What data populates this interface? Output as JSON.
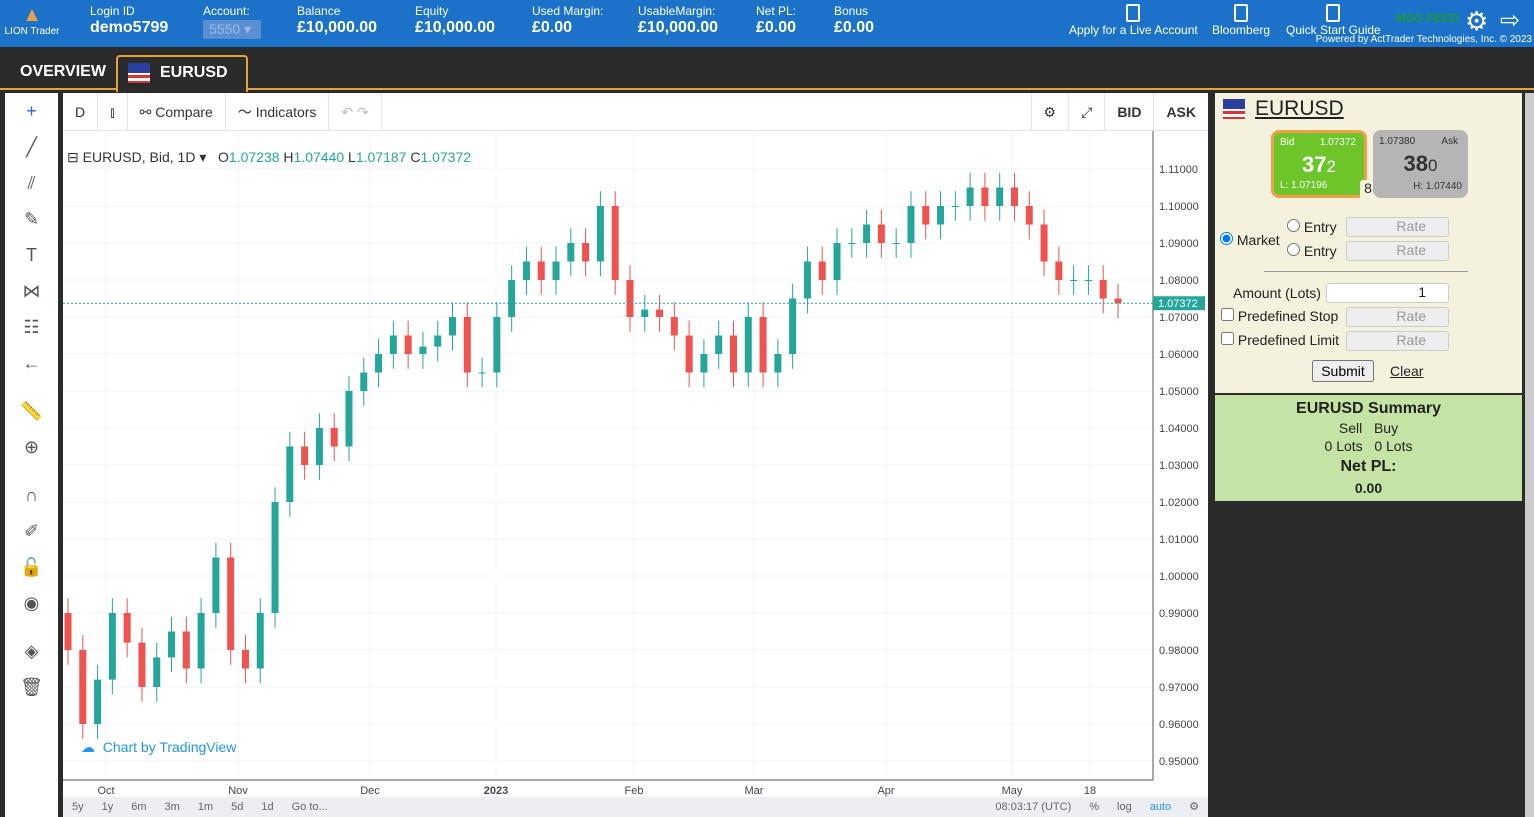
{
  "header": {
    "logo": "LION Trader",
    "login_label": "Login ID",
    "login": "demo5799",
    "account_label": "Account:",
    "account": "5550",
    "stats": [
      {
        "label": "Balance",
        "value": "£10,000.00"
      },
      {
        "label": "Equity",
        "value": "£10,000.00"
      },
      {
        "label": "Used Margin:",
        "value": "£0.00"
      },
      {
        "label": "UsableMargin:",
        "value": "£10,000.00"
      },
      {
        "label": "Net PL:",
        "value": "£0.00"
      },
      {
        "label": "Bonus",
        "value": "£0.00"
      }
    ],
    "links": [
      "Apply for a Live Account",
      "Bloomberg",
      "Quick Start Guide"
    ],
    "msg_feed": "MSG FEED",
    "powered": "Powered by ActTrader Technologies, Inc. © 2023"
  },
  "tabs": [
    "OVERVIEW",
    "EURUSD"
  ],
  "chart_toolbar": {
    "interval": "D",
    "compare": "Compare",
    "indicators": "Indicators",
    "bid": "BID",
    "ask": "ASK"
  },
  "legend": {
    "symbol": "EURUSD, Bid, 1D",
    "o": "1.07238",
    "h": "1.07440",
    "l": "1.07187",
    "c": "1.07372"
  },
  "watermark": "Chart by TradingView",
  "bottom": {
    "ranges": [
      "5y",
      "1y",
      "6m",
      "3m",
      "1m",
      "5d",
      "1d",
      "Go to..."
    ],
    "time": "08:03:17 (UTC)",
    "pct": "%",
    "log": "log",
    "auto": "auto"
  },
  "chart_data": {
    "type": "candlestick",
    "x_ticks": [
      "Oct",
      "Nov",
      "Dec",
      "2023",
      "Feb",
      "Mar",
      "Apr",
      "May",
      "18"
    ],
    "y_ticks": [
      "1.11000",
      "1.10000",
      "1.09000",
      "1.08000",
      "1.07000",
      "1.06000",
      "1.05000",
      "1.04000",
      "1.03000",
      "1.02000",
      "1.01000",
      "1.00000",
      "0.99000",
      "0.98000",
      "0.97000",
      "0.96000",
      "0.95000"
    ],
    "ylim": [
      0.945,
      1.112
    ],
    "last_price": "1.07372",
    "colors": {
      "up": "#26a69a",
      "down": "#ef5350"
    },
    "closes": [
      0.98,
      0.96,
      0.972,
      0.99,
      0.982,
      0.97,
      0.978,
      0.985,
      0.975,
      0.99,
      1.005,
      0.98,
      0.975,
      0.99,
      1.02,
      1.035,
      1.03,
      1.04,
      1.035,
      1.05,
      1.055,
      1.06,
      1.065,
      1.06,
      1.062,
      1.065,
      1.07,
      1.055,
      1.055,
      1.07,
      1.08,
      1.085,
      1.08,
      1.085,
      1.09,
      1.085,
      1.1,
      1.08,
      1.07,
      1.072,
      1.07,
      1.065,
      1.055,
      1.06,
      1.065,
      1.055,
      1.07,
      1.055,
      1.06,
      1.075,
      1.085,
      1.08,
      1.09,
      1.09,
      1.095,
      1.09,
      1.09,
      1.1,
      1.095,
      1.1,
      1.1,
      1.105,
      1.1,
      1.105,
      1.1,
      1.095,
      1.085,
      1.08,
      1.08,
      1.08,
      1.075,
      1.0737
    ]
  },
  "panel": {
    "symbol": "EURUSD",
    "bid_label": "Bid",
    "bid": "1.07372",
    "bid_big": "37",
    "bid_small": "2",
    "low": "L: 1.07196",
    "spread": "8",
    "ask_label": "Ask",
    "ask": "1.07380",
    "ask_big": "38",
    "ask_small": "0",
    "high": "H: 1.07440",
    "market": "Market",
    "entry": "Entry",
    "rate": "Rate",
    "amount_label": "Amount (Lots)",
    "amount": "1",
    "stop": "Predefined Stop",
    "limit": "Predefined Limit",
    "submit": "Submit",
    "clear": "Clear"
  },
  "summary": {
    "title": "EURUSD Summary",
    "sell": "Sell",
    "buy": "Buy",
    "sell_lots": "0 Lots",
    "buy_lots": "0 Lots",
    "netpl_label": "Net PL:",
    "netpl": "0.00"
  }
}
